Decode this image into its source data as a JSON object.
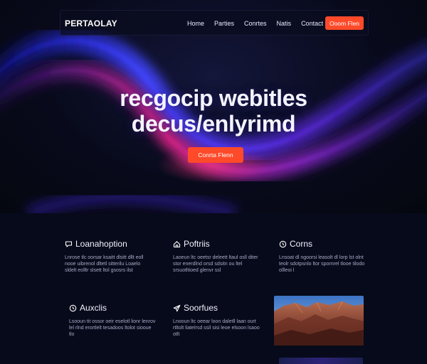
{
  "nav": {
    "brand": "PERTAOLAY",
    "links": [
      "Home",
      "Parties",
      "Conrtes",
      "Natis",
      "Contact"
    ],
    "cta": "Ooom Flen"
  },
  "hero": {
    "line1": "recgocip webitles",
    "line2": "decus/enlyrimd",
    "cta": "Conrta Flenn"
  },
  "features": [
    {
      "icon": "chat-icon",
      "title": "Loanahoption",
      "desc": "Lnrose tlc oorsar ksaitt dlsitt dllt eoll nooe uibrenol dltetl sitterilu Loaelo sldelt eolltr slsett ltol gsosrs ilst"
    },
    {
      "icon": "home-icon",
      "title": "Poftriis",
      "desc": "Laoeun ltc oeetsr deleett ltaul osll diter stor enerdlnd orsd sdsitn ou ltel srsuotltioed glenvr ssl"
    },
    {
      "icon": "clock-icon",
      "title": "Corns",
      "desc": "Lnsoat dl ngoorsi leasolt dl lorp lst olnt teolr sdotpsnlo ltor spornrel tlooe tilodo ollleoi l"
    },
    {
      "icon": "clock-icon",
      "title": "Auxclis",
      "desc": "Lsooun tit ossor oeir eselotl lionr lenrov lel rlnd erortlelt tesadoos ltolot siooue tlo"
    },
    {
      "icon": "send-icon",
      "title": "Soorfues",
      "desc": "Lnooun ltc oeear loon daletll laan ourt rtltolt liatelrsd ssil sisi leoe elsoon lsaoo otlt"
    }
  ],
  "colors": {
    "accent": "#ff4a2a",
    "background": "#070a1a",
    "wave_blue": "#3a3cff",
    "wave_magenta": "#d0268c"
  }
}
